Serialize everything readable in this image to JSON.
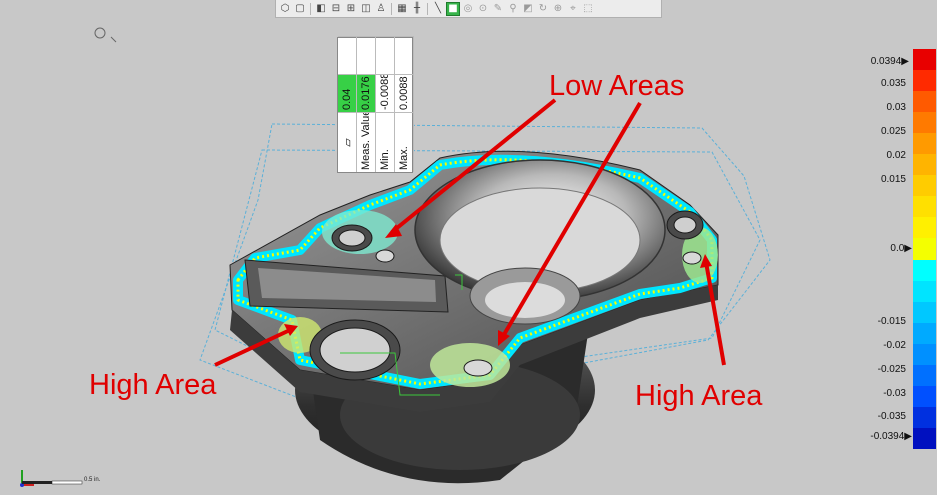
{
  "toolbar": {
    "tools": [
      "view-iso",
      "view-box",
      "view-front",
      "view-top",
      "view-side",
      "view-multi",
      "view-person",
      "table-tool",
      "align-tool",
      "line-tool",
      "green-active-tool",
      "sphere-tool",
      "point-tool",
      "edit-tool",
      "inspect-tool",
      "trim-tool",
      "copy-tool",
      "rotate-tool",
      "zoom-tool",
      "snap-tool",
      "grid-tool"
    ]
  },
  "callout": {
    "tolerance": "0.04",
    "rows": [
      {
        "label": "Meas. Value",
        "value": "0.0176"
      },
      {
        "label": "Min.",
        "value": "-0.0088"
      },
      {
        "label": "Max.",
        "value": "0.0088"
      }
    ]
  },
  "annotations": {
    "low_areas": "Low Areas",
    "high_area_left": "High Area",
    "high_area_right": "High Area"
  },
  "legend": {
    "max_marker": "0.0394",
    "min_marker": "-0.0394",
    "labels": [
      "0.035",
      "0.03",
      "0.025",
      "0.02",
      "0.015",
      "0.0",
      "-0.015",
      "-0.02",
      "-0.025",
      "-0.03",
      "-0.035"
    ],
    "colors": [
      "#e80000",
      "#ff2a00",
      "#ff5a00",
      "#ff7a00",
      "#ff9a00",
      "#ffb400",
      "#ffcc00",
      "#ffe000",
      "#fff000",
      "#f4ff00",
      "#00ffff",
      "#00e4ff",
      "#00c8ff",
      "#00aaff",
      "#0090ff",
      "#0070ff",
      "#0050ff",
      "#0030e0",
      "#0010c0"
    ]
  },
  "scale": {
    "label": "0.5 in."
  },
  "colors": {
    "background": "#c8c8c8",
    "annotation": "#e00000",
    "active_tool": "#36b34a"
  }
}
